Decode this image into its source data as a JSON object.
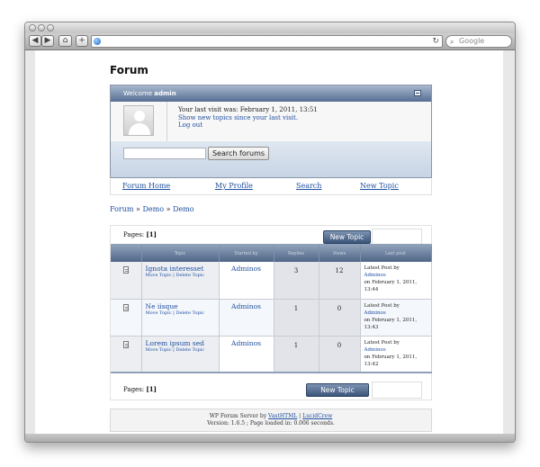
{
  "browser": {
    "search_placeholder": "Google",
    "reload_glyph": "↻"
  },
  "page": {
    "title": "Forum"
  },
  "welcome": {
    "prefix": "Welcome",
    "user": "admin",
    "last_visit": "Your last visit was: February 1, 2011, 13:51",
    "new_topics_link": "Show new topics since your last visit.",
    "logout_link": "Log out",
    "search_button": "Search forums",
    "search_value": ""
  },
  "nav": {
    "home": "Forum Home",
    "profile": "My Profile",
    "search": "Search",
    "new_topic": "New Topic"
  },
  "breadcrumb": {
    "items": [
      "Forum",
      "Demo",
      "Demo"
    ],
    "separator": "»"
  },
  "pagination": {
    "label": "Pages:",
    "current": "[1]"
  },
  "new_topic_button": "New Topic",
  "table": {
    "headers": [
      "",
      "Topic",
      "Started by",
      "Replies",
      "Views",
      "Last post"
    ],
    "rows": [
      {
        "topic": "Ignota interesset",
        "move": "Move Topic",
        "delete": "Delete Topic",
        "starter": "Adminos",
        "replies": "3",
        "views": "12",
        "last_label": "Latest Post by",
        "last_user": "Adminos",
        "last_date": "on February 1, 2011, 13:44"
      },
      {
        "topic": "Ne iisque",
        "move": "Move Topic",
        "delete": "Delete Topic",
        "starter": "Adminos",
        "replies": "1",
        "views": "0",
        "last_label": "Latest Post by",
        "last_user": "Adminos",
        "last_date": "on February 1, 2011, 13:43"
      },
      {
        "topic": "Lorem ipsum sed",
        "move": "Move Topic",
        "delete": "Delete Topic",
        "starter": "Adminos",
        "replies": "1",
        "views": "0",
        "last_label": "Latest Post by",
        "last_user": "Adminos",
        "last_date": "on February 1, 2011, 13:42"
      }
    ]
  },
  "footer": {
    "line1_prefix": "WP Forum Server by",
    "vast_link": "VastHTML",
    "pipe": "|",
    "lucid_link": "LucidCrew",
    "line2": "Version: 1.6.5 ; Page loaded in: 0.006 seconds."
  }
}
